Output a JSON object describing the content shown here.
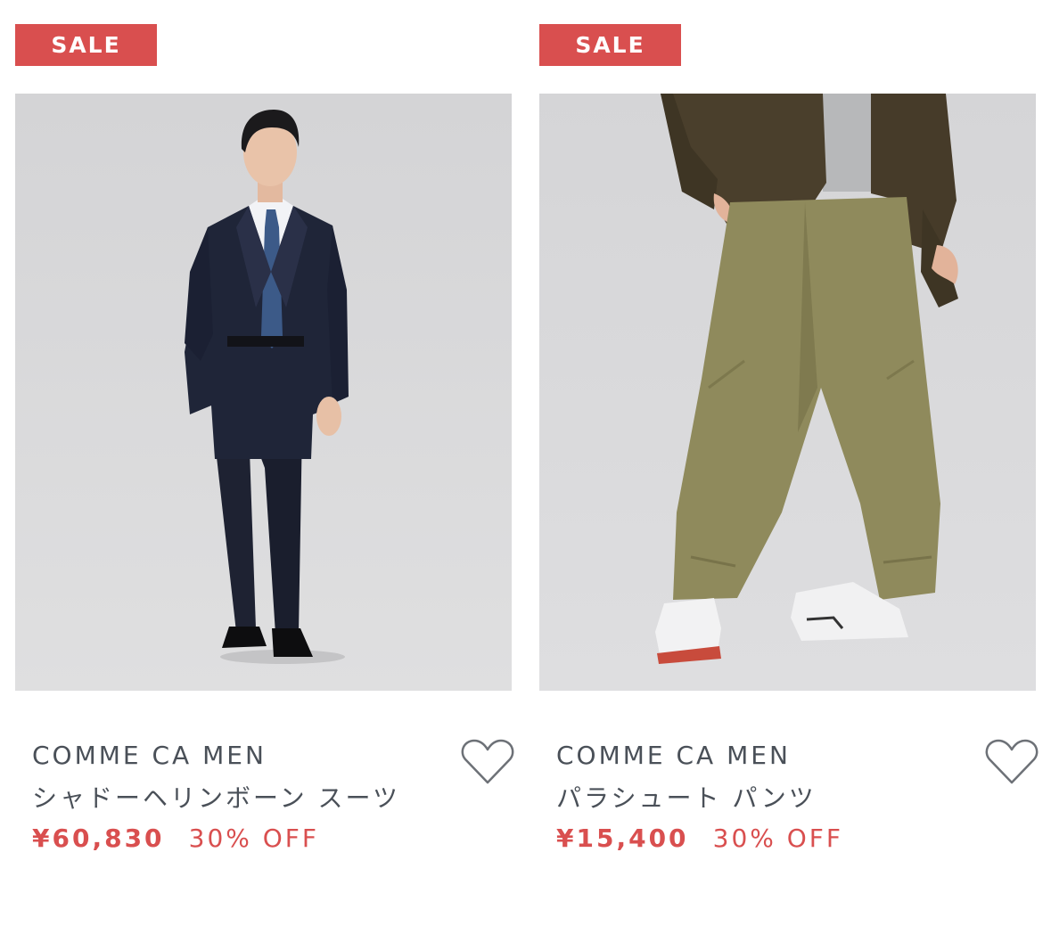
{
  "products": [
    {
      "badge": "SALE",
      "brand": "COMME CA MEN",
      "name": "シャドーヘリンボーン スーツ",
      "price": "¥60,830",
      "discount": "30% OFF",
      "image_alt": "シャドーヘリンボーン スーツ"
    },
    {
      "badge": "SALE",
      "brand": "COMME CA MEN",
      "name": "パラシュート パンツ",
      "price": "¥15,400",
      "discount": "30% OFF",
      "image_alt": "パラシュート パンツ"
    }
  ],
  "colors": {
    "sale_red": "#d94f4f",
    "text_gray": "#4a5058",
    "photo_bg": "#d9d9da"
  },
  "icons": {
    "favorite": "heart-outline-icon"
  }
}
